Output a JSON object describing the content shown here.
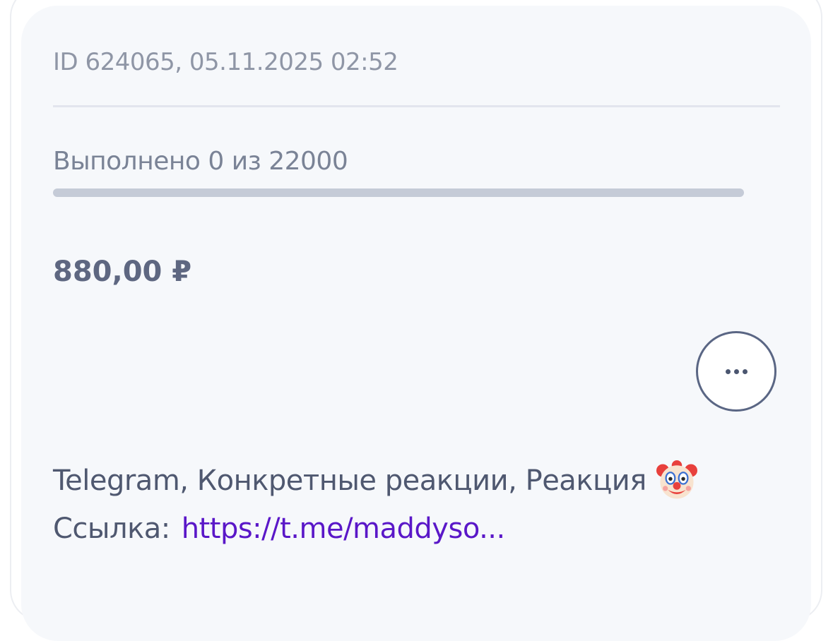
{
  "order": {
    "meta": "ID 624065, 05.11.2025 02:52",
    "progress_label": "Выполнено 0 из 22000",
    "progress": {
      "done": 0,
      "total": 22000,
      "fraction": 0
    },
    "price": "880,00 ₽",
    "service": "Telegram, Конкретные реакции, Реакция",
    "service_icon": "clown-face-emoji",
    "link_label": "Ссылка:",
    "link_url": "https://t.me/maddyso..."
  },
  "actions": {
    "more_icon": "ellipsis-icon"
  },
  "colors": {
    "card_background": "#f6f8fb",
    "progress_track": "#c5cbd7",
    "link": "#5a17c8",
    "text_primary": "#4f5870",
    "text_muted": "#8f96a6"
  }
}
